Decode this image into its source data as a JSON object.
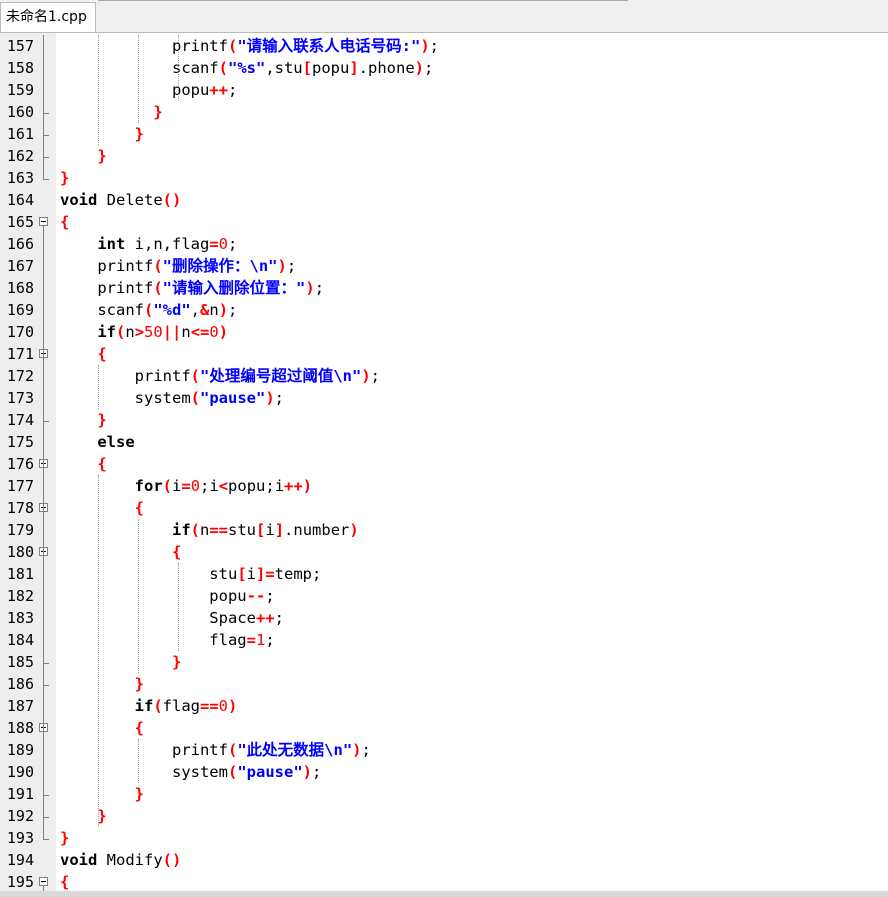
{
  "tab": {
    "filename": "未命名1.cpp"
  },
  "lines": [
    {
      "num": "157",
      "tokens": [
        [
          "t",
          "            printf"
        ],
        [
          "o",
          "("
        ],
        [
          "s",
          "\"请输入联系人电话号码:\""
        ],
        [
          "o",
          ")"
        ],
        [
          "t",
          ";"
        ]
      ]
    },
    {
      "num": "158",
      "tokens": [
        [
          "t",
          "            scanf"
        ],
        [
          "o",
          "("
        ],
        [
          "s",
          "\"%s\""
        ],
        [
          "t",
          ",stu"
        ],
        [
          "o",
          "["
        ],
        [
          "t",
          "popu"
        ],
        [
          "o",
          "]"
        ],
        [
          "t",
          ".phone"
        ],
        [
          "o",
          ")"
        ],
        [
          "t",
          ";"
        ]
      ]
    },
    {
      "num": "159",
      "tokens": [
        [
          "t",
          "            popu"
        ],
        [
          "o",
          "++"
        ],
        [
          "t",
          ";"
        ]
      ]
    },
    {
      "num": "160",
      "tokens": [
        [
          "o",
          "          }"
        ]
      ]
    },
    {
      "num": "161",
      "tokens": [
        [
          "o",
          "        }"
        ]
      ]
    },
    {
      "num": "162",
      "tokens": [
        [
          "o",
          "    }"
        ]
      ]
    },
    {
      "num": "163",
      "tokens": [
        [
          "o",
          "}"
        ]
      ]
    },
    {
      "num": "164",
      "tokens": [
        [
          "k",
          "void"
        ],
        [
          "t",
          " Delete"
        ],
        [
          "o",
          "()"
        ]
      ]
    },
    {
      "num": "165",
      "tokens": [
        [
          "o",
          "{"
        ]
      ]
    },
    {
      "num": "166",
      "tokens": [
        [
          "t",
          "    "
        ],
        [
          "k",
          "int"
        ],
        [
          "t",
          " i,n,flag"
        ],
        [
          "o",
          "="
        ],
        [
          "n",
          "0"
        ],
        [
          "t",
          ";"
        ]
      ]
    },
    {
      "num": "167",
      "tokens": [
        [
          "t",
          "    printf"
        ],
        [
          "o",
          "("
        ],
        [
          "s",
          "\"删除操作：\\n\""
        ],
        [
          "o",
          ")"
        ],
        [
          "t",
          ";"
        ]
      ]
    },
    {
      "num": "168",
      "tokens": [
        [
          "t",
          "    printf"
        ],
        [
          "o",
          "("
        ],
        [
          "s",
          "\"请输入删除位置：\""
        ],
        [
          "o",
          ")"
        ],
        [
          "t",
          ";"
        ]
      ]
    },
    {
      "num": "169",
      "tokens": [
        [
          "t",
          "    scanf"
        ],
        [
          "o",
          "("
        ],
        [
          "s",
          "\"%d\""
        ],
        [
          "t",
          ","
        ],
        [
          "o",
          "&"
        ],
        [
          "t",
          "n"
        ],
        [
          "o",
          ")"
        ],
        [
          "t",
          ";"
        ]
      ]
    },
    {
      "num": "170",
      "tokens": [
        [
          "t",
          "    "
        ],
        [
          "k",
          "if"
        ],
        [
          "o",
          "("
        ],
        [
          "t",
          "n"
        ],
        [
          "o",
          ">"
        ],
        [
          "n",
          "50"
        ],
        [
          "o",
          "||"
        ],
        [
          "t",
          "n"
        ],
        [
          "o",
          "<="
        ],
        [
          "n",
          "0"
        ],
        [
          "o",
          ")"
        ]
      ]
    },
    {
      "num": "171",
      "tokens": [
        [
          "o",
          "    {"
        ]
      ]
    },
    {
      "num": "172",
      "tokens": [
        [
          "t",
          "        printf"
        ],
        [
          "o",
          "("
        ],
        [
          "s",
          "\"处理编号超过阈值\\n\""
        ],
        [
          "o",
          ")"
        ],
        [
          "t",
          ";"
        ]
      ]
    },
    {
      "num": "173",
      "tokens": [
        [
          "t",
          "        system"
        ],
        [
          "o",
          "("
        ],
        [
          "s",
          "\"pause\""
        ],
        [
          "o",
          ")"
        ],
        [
          "t",
          ";"
        ]
      ]
    },
    {
      "num": "174",
      "tokens": [
        [
          "o",
          "    }"
        ]
      ]
    },
    {
      "num": "175",
      "tokens": [
        [
          "t",
          "    "
        ],
        [
          "k",
          "else"
        ]
      ]
    },
    {
      "num": "176",
      "tokens": [
        [
          "o",
          "    {"
        ]
      ]
    },
    {
      "num": "177",
      "tokens": [
        [
          "t",
          "        "
        ],
        [
          "k",
          "for"
        ],
        [
          "o",
          "("
        ],
        [
          "t",
          "i"
        ],
        [
          "o",
          "="
        ],
        [
          "n",
          "0"
        ],
        [
          "t",
          ";i"
        ],
        [
          "o",
          "<"
        ],
        [
          "t",
          "popu;i"
        ],
        [
          "o",
          "++)"
        ]
      ]
    },
    {
      "num": "178",
      "tokens": [
        [
          "o",
          "        {"
        ]
      ]
    },
    {
      "num": "179",
      "tokens": [
        [
          "t",
          "            "
        ],
        [
          "k",
          "if"
        ],
        [
          "o",
          "("
        ],
        [
          "t",
          "n"
        ],
        [
          "o",
          "=="
        ],
        [
          "t",
          "stu"
        ],
        [
          "o",
          "["
        ],
        [
          "t",
          "i"
        ],
        [
          "o",
          "]"
        ],
        [
          "t",
          ".number"
        ],
        [
          "o",
          ")"
        ]
      ]
    },
    {
      "num": "180",
      "tokens": [
        [
          "o",
          "            {"
        ]
      ]
    },
    {
      "num": "181",
      "tokens": [
        [
          "t",
          "                stu"
        ],
        [
          "o",
          "["
        ],
        [
          "t",
          "i"
        ],
        [
          "o",
          "]="
        ],
        [
          "t",
          "temp;"
        ]
      ]
    },
    {
      "num": "182",
      "tokens": [
        [
          "t",
          "                popu"
        ],
        [
          "o",
          "--"
        ],
        [
          "t",
          ";"
        ]
      ]
    },
    {
      "num": "183",
      "tokens": [
        [
          "t",
          "                Space"
        ],
        [
          "o",
          "++"
        ],
        [
          "t",
          ";"
        ]
      ]
    },
    {
      "num": "184",
      "tokens": [
        [
          "t",
          "                flag"
        ],
        [
          "o",
          "="
        ],
        [
          "n",
          "1"
        ],
        [
          "t",
          ";"
        ]
      ]
    },
    {
      "num": "185",
      "tokens": [
        [
          "o",
          "            }"
        ]
      ]
    },
    {
      "num": "186",
      "tokens": [
        [
          "o",
          "        }"
        ]
      ]
    },
    {
      "num": "187",
      "tokens": [
        [
          "t",
          "        "
        ],
        [
          "k",
          "if"
        ],
        [
          "o",
          "("
        ],
        [
          "t",
          "flag"
        ],
        [
          "o",
          "=="
        ],
        [
          "n",
          "0"
        ],
        [
          "o",
          ")"
        ]
      ]
    },
    {
      "num": "188",
      "tokens": [
        [
          "o",
          "        {"
        ]
      ]
    },
    {
      "num": "189",
      "tokens": [
        [
          "t",
          "            printf"
        ],
        [
          "o",
          "("
        ],
        [
          "s",
          "\"此处无数据\\n\""
        ],
        [
          "o",
          ")"
        ],
        [
          "t",
          ";"
        ]
      ]
    },
    {
      "num": "190",
      "tokens": [
        [
          "t",
          "            system"
        ],
        [
          "o",
          "("
        ],
        [
          "s",
          "\"pause\""
        ],
        [
          "o",
          ")"
        ],
        [
          "t",
          ";"
        ]
      ]
    },
    {
      "num": "191",
      "tokens": [
        [
          "o",
          "        }"
        ]
      ]
    },
    {
      "num": "192",
      "tokens": [
        [
          "o",
          "    }"
        ]
      ]
    },
    {
      "num": "193",
      "tokens": [
        [
          "o",
          "}"
        ]
      ]
    },
    {
      "num": "194",
      "tokens": [
        [
          "k",
          "void"
        ],
        [
          "t",
          " Modify"
        ],
        [
          "o",
          "()"
        ]
      ]
    },
    {
      "num": "195",
      "tokens": [
        [
          "o",
          "{"
        ]
      ]
    }
  ],
  "colors": {
    "operator": "#ff0000",
    "string": "#0000ff",
    "keyword": "#000000",
    "gutter": "#eeeeee"
  }
}
